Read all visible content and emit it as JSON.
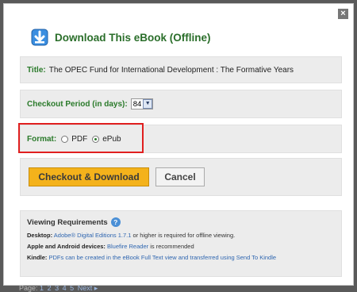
{
  "background": {
    "pager": {
      "label": "Page:",
      "pages": [
        "1",
        "2",
        "3",
        "4",
        "5"
      ],
      "next": "Next ▸"
    }
  },
  "dialog": {
    "close_label": "×",
    "title": "Download This eBook (Offline)",
    "title_icon": "download-arrow-icon",
    "book": {
      "label": "Title:",
      "value": "The OPEC Fund for International Development : The Formative Years"
    },
    "checkout_period": {
      "label": "Checkout Period (in days):",
      "selected": "84"
    },
    "format": {
      "label": "Format:",
      "options": [
        {
          "label": "PDF",
          "checked": false
        },
        {
          "label": "ePub",
          "checked": true
        }
      ]
    },
    "buttons": {
      "checkout": "Checkout & Download",
      "cancel": "Cancel"
    },
    "requirements": {
      "heading": "Viewing Requirements",
      "desktop_label": "Desktop:",
      "desktop_link": "Adobe® Digital Editions 1.7.1",
      "desktop_text": " or higher is required for offline viewing.",
      "mobile_label": "Apple and Android devices:",
      "mobile_link": "Bluefire Reader",
      "mobile_text": " is recommended",
      "kindle_label": "Kindle:",
      "kindle_text": " PDFs can be created in the eBook Full Text view and transferred using Send To Kindle"
    }
  },
  "colors": {
    "title_green": "#2a6e2a",
    "checkout_orange": "#f4b21b",
    "highlight_red": "#e01f1f",
    "link_blue": "#2f66b0"
  }
}
